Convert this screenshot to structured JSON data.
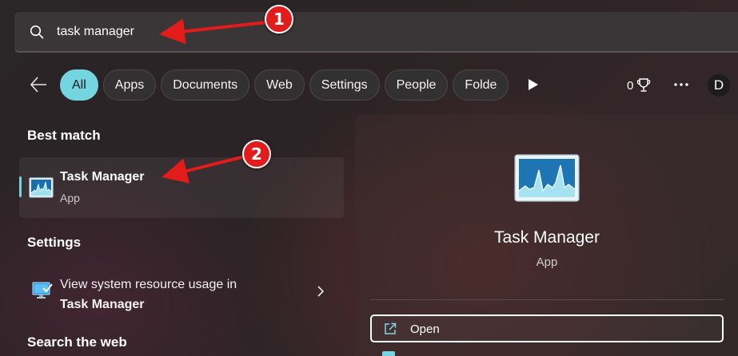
{
  "search": {
    "value": "task manager"
  },
  "filters": {
    "chips": [
      {
        "label": "All",
        "active": true
      },
      {
        "label": "Apps"
      },
      {
        "label": "Documents"
      },
      {
        "label": "Web"
      },
      {
        "label": "Settings"
      },
      {
        "label": "People"
      },
      {
        "label": "Folde"
      }
    ],
    "points": "0",
    "avatar_initial": "D"
  },
  "best_match": {
    "heading": "Best match",
    "title": "Task Manager",
    "subtitle": "App"
  },
  "settings": {
    "heading": "Settings",
    "item_line1": "View system resource usage in",
    "item_line2": "Task Manager"
  },
  "web": {
    "heading": "Search the web"
  },
  "preview": {
    "title": "Task Manager",
    "subtitle": "App",
    "open_label": "Open"
  },
  "annotations": {
    "step1": "1",
    "step2": "2"
  },
  "colors": {
    "accent": "#74d4df",
    "annotation": "#e21b1b"
  }
}
